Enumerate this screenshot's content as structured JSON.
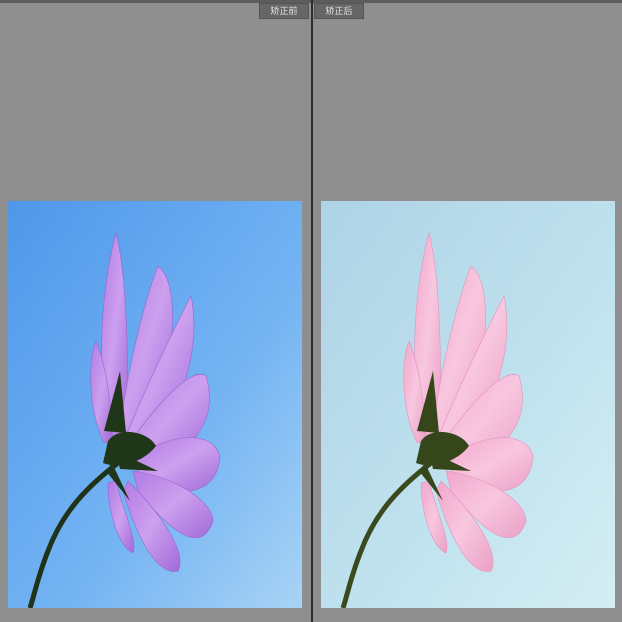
{
  "tabs": {
    "before_label": "矫正前",
    "after_label": "矫正后"
  },
  "colors": {
    "workspace_bg": "#8f8f8f",
    "divider": "#2c2c2c",
    "before_sky_top": "#5aa2ee",
    "before_sky_bottom": "#8fc6f5",
    "before_petal": "#c08ae8",
    "after_sky_top": "#b7dcea",
    "after_sky_bottom": "#cdebf2",
    "after_petal": "#f3b6d6",
    "stem": "#263a1c"
  },
  "images": {
    "before": "flower-photo-original",
    "after": "flower-photo-corrected"
  }
}
